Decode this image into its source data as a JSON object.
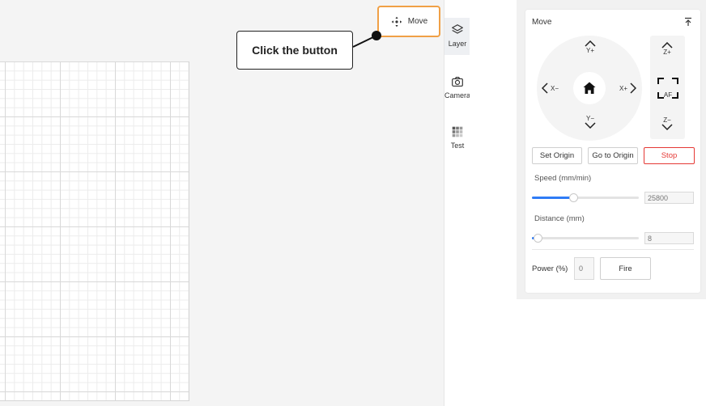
{
  "callout": {
    "text": "Click the button"
  },
  "toolbar": {
    "move_label": "Move"
  },
  "tool_strip": {
    "items": [
      {
        "label": "Layer",
        "icon": "layers-icon"
      },
      {
        "label": "Camera",
        "icon": "camera-icon"
      },
      {
        "label": "Test",
        "icon": "grid-test-icon"
      }
    ]
  },
  "panel": {
    "title": "Move",
    "jog": {
      "y_plus": "Y+",
      "y_minus": "Y−",
      "x_minus": "X−",
      "x_plus": "X+",
      "z_plus": "Z+",
      "af": "AF",
      "z_minus": "Z−"
    },
    "buttons": {
      "set_origin": "Set Origin",
      "go_to_origin": "Go to Origin",
      "stop": "Stop"
    },
    "speed": {
      "label": "Speed (mm/min)",
      "value": "25800",
      "level": 0.39
    },
    "distance": {
      "label": "Distance (mm)",
      "value": "8",
      "level": 0.05
    },
    "power": {
      "label": "Power (%)",
      "value": "0"
    },
    "fire_label": "Fire"
  },
  "colors": {
    "accent": "#2f7cf6",
    "highlight": "#f0a046",
    "stop": "#e53935"
  }
}
